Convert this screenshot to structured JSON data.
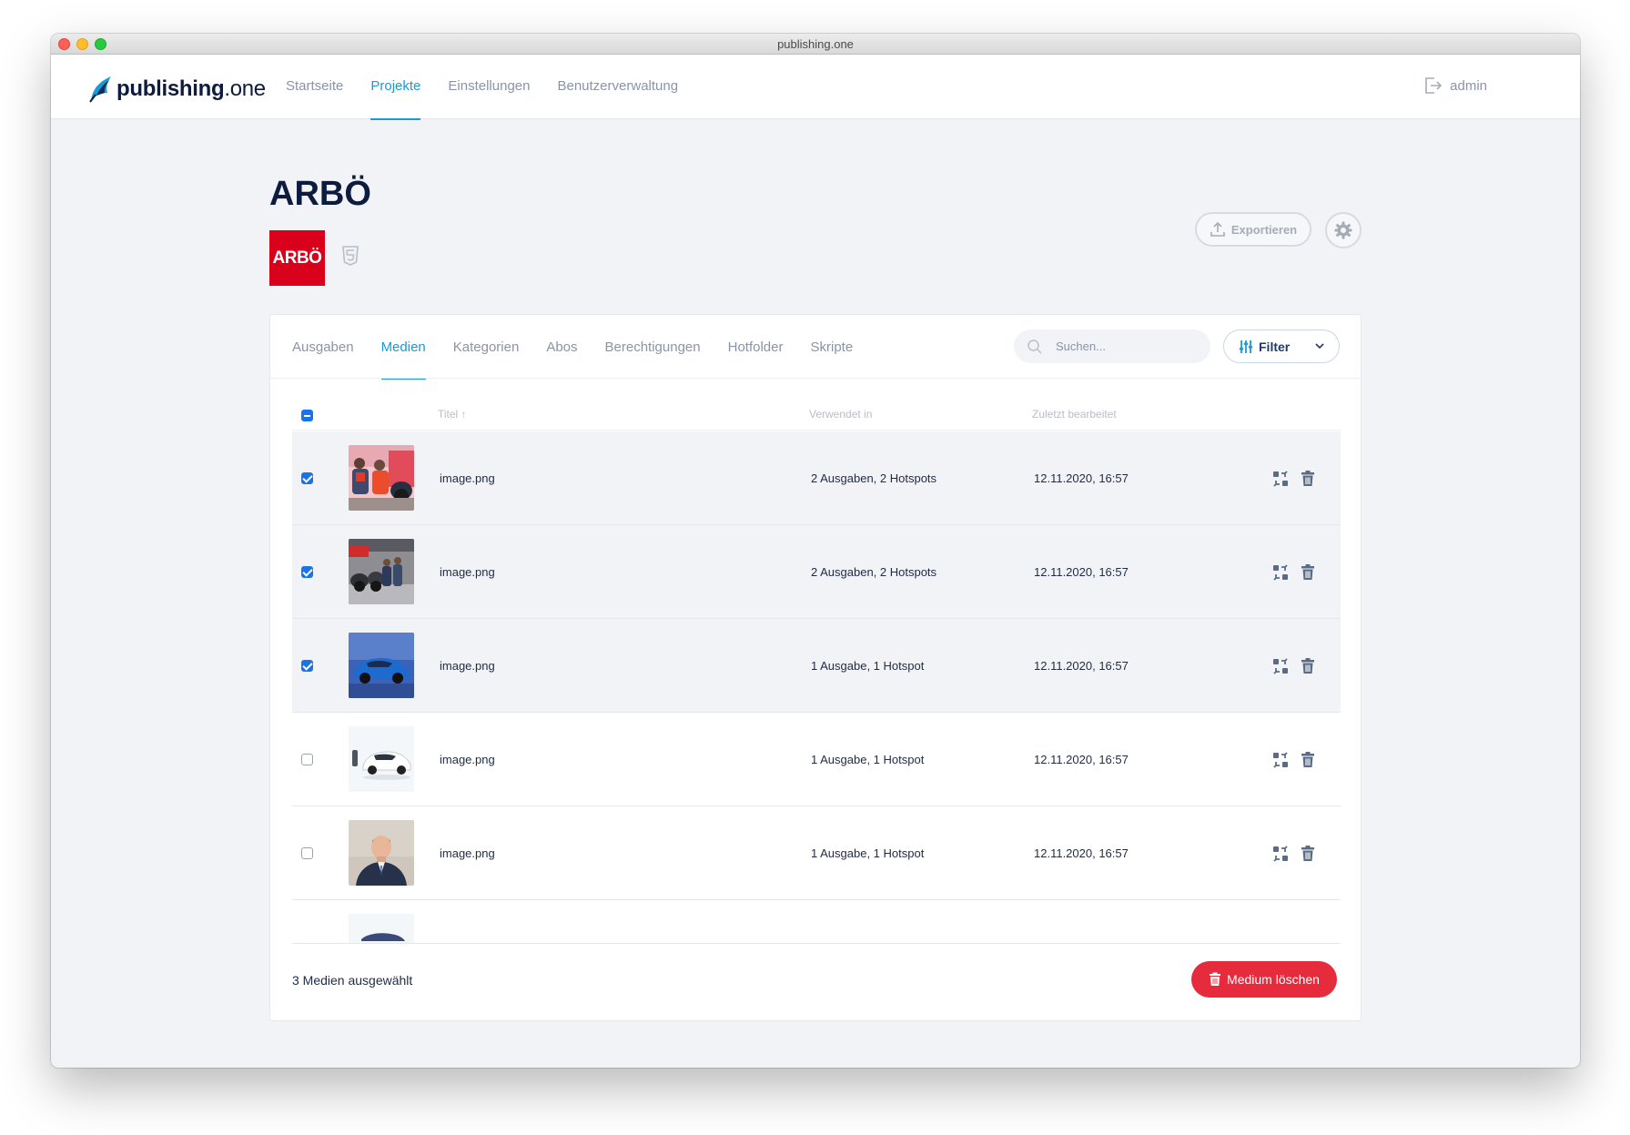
{
  "window": {
    "title": "publishing.one"
  },
  "brand": {
    "name_bold": "publishing",
    "name_rest": ".one"
  },
  "nav": {
    "items": [
      {
        "label": "Startseite",
        "active": false
      },
      {
        "label": "Projekte",
        "active": true
      },
      {
        "label": "Einstellungen",
        "active": false
      },
      {
        "label": "Benutzerverwaltung",
        "active": false
      }
    ]
  },
  "user": {
    "name": "admin",
    "icon": "logout-icon"
  },
  "project": {
    "title": "ARBÖ",
    "logo_text": "ARBÖ",
    "logo_color": "#d9001b",
    "type_icon": "html5-icon",
    "export_label": "Exportieren",
    "settings_icon": "gear-icon"
  },
  "tabs": {
    "items": [
      {
        "label": "Ausgaben",
        "active": false
      },
      {
        "label": "Medien",
        "active": true
      },
      {
        "label": "Kategorien",
        "active": false
      },
      {
        "label": "Abos",
        "active": false
      },
      {
        "label": "Berechtigungen",
        "active": false
      },
      {
        "label": "Hotfolder",
        "active": false
      },
      {
        "label": "Skripte",
        "active": false
      }
    ]
  },
  "search": {
    "placeholder": "Suchen...",
    "value": ""
  },
  "filter": {
    "label": "Filter"
  },
  "table": {
    "columns": {
      "title": "Titel ↑",
      "used_in": "Verwendet in",
      "last_edited": "Zuletzt bearbeitet"
    },
    "rows": [
      {
        "title": "image.png",
        "used_in": "2 Ausgaben, 2 Hotspots",
        "last_edited": "12.11.2020, 16:57",
        "checked": true,
        "thumb": "motorcyclists-red"
      },
      {
        "title": "image.png",
        "used_in": "2 Ausgaben, 2 Hotspots",
        "last_edited": "12.11.2020, 16:57",
        "checked": true,
        "thumb": "motorcycles-garage"
      },
      {
        "title": "image.png",
        "used_in": "1 Ausgabe, 1 Hotspot",
        "last_edited": "12.11.2020, 16:57",
        "checked": true,
        "thumb": "blue-car"
      },
      {
        "title": "image.png",
        "used_in": "1 Ausgabe, 1 Hotspot",
        "last_edited": "12.11.2020, 16:57",
        "checked": false,
        "thumb": "white-car-charger"
      },
      {
        "title": "image.png",
        "used_in": "1 Ausgabe, 1 Hotspot",
        "last_edited": "12.11.2020, 16:57",
        "checked": false,
        "thumb": "portrait-man"
      },
      {
        "title": "",
        "used_in": "",
        "last_edited": "",
        "checked": false,
        "thumb": "dark-car-partial"
      }
    ]
  },
  "footer": {
    "selected_text": "3 Medien ausgewählt",
    "delete_label": "Medium löschen"
  },
  "colors": {
    "accent": "#1a9ad6",
    "danger": "#e52b3c",
    "checkbox": "#1a73e8"
  }
}
